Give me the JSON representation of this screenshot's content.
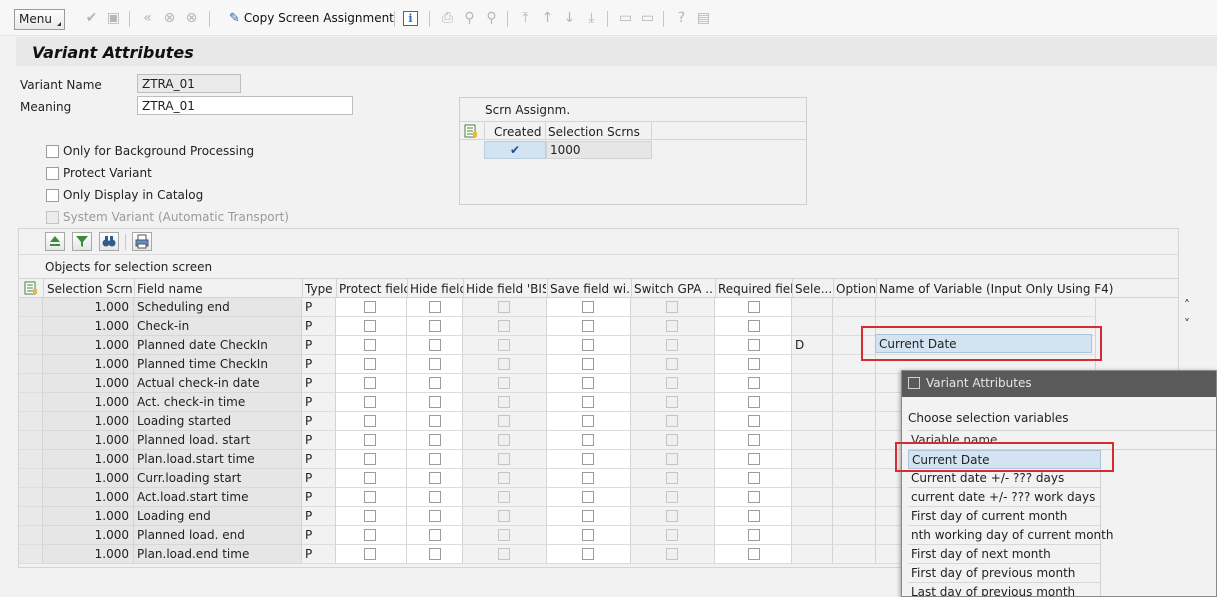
{
  "toolbar": {
    "menu_label": "Menu",
    "copy_label": "Copy Screen Assignment"
  },
  "title": "Variant Attributes",
  "form": {
    "variant_name_label": "Variant Name",
    "variant_name_value": "ZTRA_01",
    "meaning_label": "Meaning",
    "meaning_value": "ZTRA_01"
  },
  "options": [
    {
      "label": "Only for Background Processing",
      "checked": false,
      "disabled": false
    },
    {
      "label": "Protect Variant",
      "checked": false,
      "disabled": false
    },
    {
      "label": "Only Display in Catalog",
      "checked": false,
      "disabled": false
    },
    {
      "label": "System Variant (Automatic Transport)",
      "checked": false,
      "disabled": true
    }
  ],
  "scrn_assign": {
    "title": "Scrn Assignm.",
    "col_created": "Created",
    "col_screens": "Selection Scrns",
    "row_screen": "1000",
    "row_created": true
  },
  "objects": {
    "title": "Objects for selection screen",
    "columns": [
      "Selection Scrns",
      "Field name",
      "Type",
      "Protect field",
      "Hide field",
      "Hide field 'BIS'",
      "Save field wi...",
      "Switch GPA ...",
      "Required field",
      "Sele...",
      "Option",
      "Name of Variable (Input Only Using F4)"
    ],
    "rows": [
      {
        "scr": "1.000",
        "field": "Scheduling end",
        "type": "P",
        "sel": ""
      },
      {
        "scr": "1.000",
        "field": "Check-in",
        "type": "P",
        "sel": ""
      },
      {
        "scr": "1.000",
        "field": "Planned date CheckIn",
        "type": "P",
        "sel": "D"
      },
      {
        "scr": "1.000",
        "field": "Planned time CheckIn",
        "type": "P",
        "sel": ""
      },
      {
        "scr": "1.000",
        "field": "Actual check-in date",
        "type": "P",
        "sel": ""
      },
      {
        "scr": "1.000",
        "field": "Act. check-in time",
        "type": "P",
        "sel": ""
      },
      {
        "scr": "1.000",
        "field": "Loading started",
        "type": "P",
        "sel": ""
      },
      {
        "scr": "1.000",
        "field": "Planned load. start",
        "type": "P",
        "sel": ""
      },
      {
        "scr": "1.000",
        "field": "Plan.load.start time",
        "type": "P",
        "sel": ""
      },
      {
        "scr": "1.000",
        "field": "Curr.loading start",
        "type": "P",
        "sel": ""
      },
      {
        "scr": "1.000",
        "field": "Act.load.start time",
        "type": "P",
        "sel": ""
      },
      {
        "scr": "1.000",
        "field": "Loading end",
        "type": "P",
        "sel": ""
      },
      {
        "scr": "1.000",
        "field": "Planned load. end",
        "type": "P",
        "sel": ""
      },
      {
        "scr": "1.000",
        "field": "Plan.load.end time",
        "type": "P",
        "sel": ""
      }
    ],
    "variable_value": "Current Date"
  },
  "popup": {
    "title": "Variant Attributes",
    "hint": "Choose selection variables",
    "col_header": "Variable name",
    "items": [
      "Current Date",
      "Current date +/- ??? days",
      "current date +/- ??? work days",
      "First day of current month",
      "nth working day of current month",
      "First day of next month",
      "First day of previous month",
      "Last day of previous month"
    ]
  },
  "colors": {
    "highlight": "#d3e3f1",
    "annotation_red": "#d52b34",
    "popup_titlebar": "#5a5a5a"
  }
}
